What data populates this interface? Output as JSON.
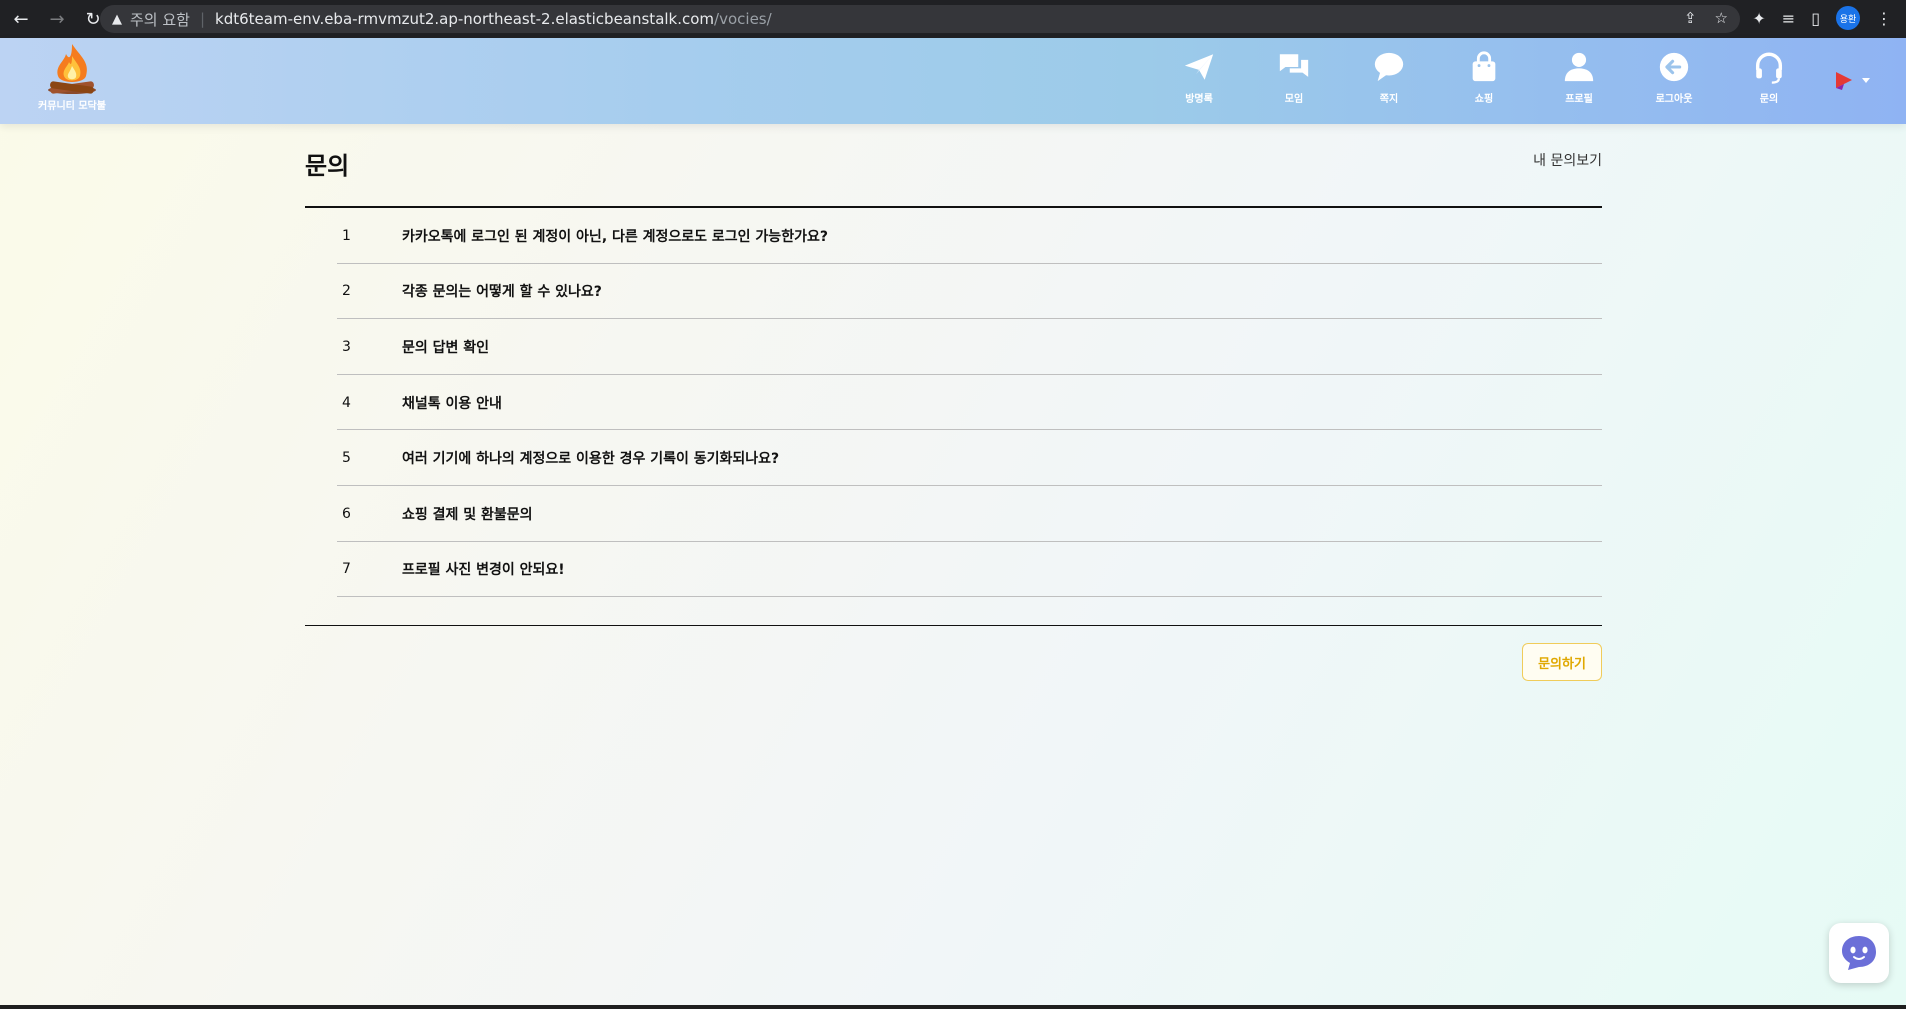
{
  "browser": {
    "security_label": "주의 요함",
    "url_host": "kdt6team-env.eba-rmvmzut2.ap-northeast-2.elasticbeanstalk.com",
    "url_path": "/vocies/",
    "profile_initials": "용환"
  },
  "header": {
    "logo_text": "커뮤니티 모닥불",
    "nav": [
      {
        "label": "방명록",
        "icon": "paper-plane-icon"
      },
      {
        "label": "모임",
        "icon": "chat-bubbles-icon"
      },
      {
        "label": "쪽지",
        "icon": "speech-bubble-icon"
      },
      {
        "label": "쇼핑",
        "icon": "shopping-bag-icon"
      },
      {
        "label": "프로필",
        "icon": "person-icon"
      },
      {
        "label": "로그아웃",
        "icon": "logout-arrow-icon"
      },
      {
        "label": "문의",
        "icon": "headset-icon"
      }
    ]
  },
  "main": {
    "title": "문의",
    "my_inquiries_link": "내 문의보기",
    "faq": [
      {
        "num": "1",
        "question": "카카오톡에 로그인 된 계정이 아닌, 다른 계정으로도 로그인 가능한가요?"
      },
      {
        "num": "2",
        "question": "각종 문의는 어떻게 할 수 있나요?"
      },
      {
        "num": "3",
        "question": "문의 답변 확인"
      },
      {
        "num": "4",
        "question": "채널톡 이용 안내"
      },
      {
        "num": "5",
        "question": "여러 기기에 하나의 계정으로 이용한 경우 기록이 동기화되나요?"
      },
      {
        "num": "6",
        "question": "쇼핑 결제 및 환불문의"
      },
      {
        "num": "7",
        "question": "프로필 사진 변경이 안되요!"
      }
    ],
    "ask_button": "문의하기"
  },
  "colors": {
    "header_gradient_start": "#bcd3f3",
    "header_gradient_end": "#8fb3f3",
    "ask_button_accent": "#e0a800",
    "chatbot_accent": "#6b6fd8"
  }
}
